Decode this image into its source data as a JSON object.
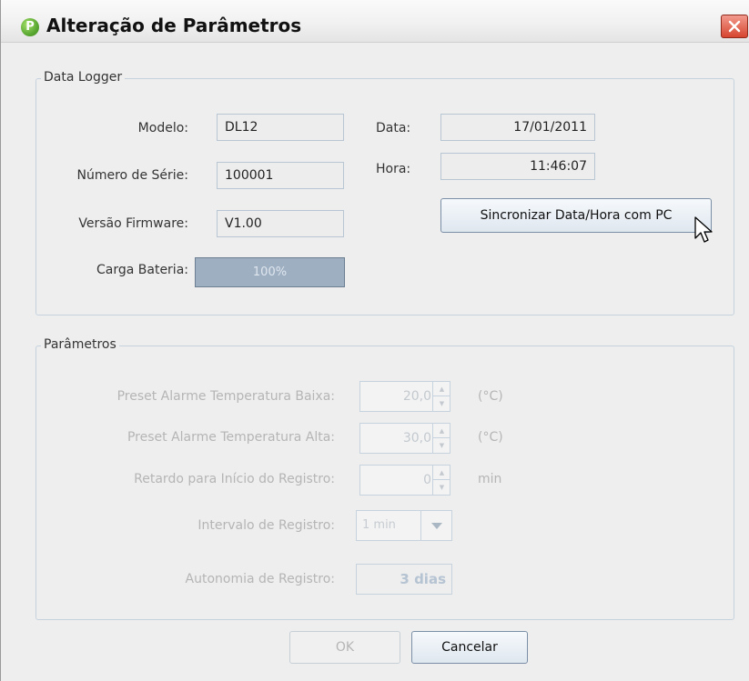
{
  "window": {
    "title": "Alteração de Parâmetros",
    "app_icon_letter": "P"
  },
  "data_logger": {
    "group_title": "Data Logger",
    "modelo_label": "Modelo:",
    "modelo_value": "DL12",
    "numero_serie_label": "Número de Série:",
    "numero_serie_value": "100001",
    "versao_firmware_label": "Versão Firmware:",
    "versao_firmware_value": "V1.00",
    "carga_bateria_label": "Carga Bateria:",
    "carga_bateria_text": "100%",
    "carga_bateria_level": 1.0,
    "data_label": "Data:",
    "data_value": "17/01/2011",
    "hora_label": "Hora:",
    "hora_value": "11:46:07",
    "sync_button_label": "Sincronizar Data/Hora com PC"
  },
  "parametros": {
    "group_title": "Parâmetros",
    "preset_baixa_label": "Preset Alarme Temperatura Baixa:",
    "preset_baixa_value": "20,0",
    "preset_baixa_unit": "(°C)",
    "preset_alta_label": "Preset Alarme Temperatura Alta:",
    "preset_alta_value": "30,0",
    "preset_alta_unit": "(°C)",
    "retardo_label": "Retardo para Início do Registro:",
    "retardo_value": "0",
    "retardo_unit": "min",
    "intervalo_label": "Intervalo de Registro:",
    "intervalo_value": "1 min",
    "autonomia_label": "Autonomia de Registro:",
    "autonomia_value": "3 dias"
  },
  "buttons": {
    "ok_label": "OK",
    "cancel_label": "Cancelar"
  },
  "colors": {
    "window_bg": "#eeeeee",
    "group_border": "#c5d2de",
    "battery_fill": "#a2b2c4",
    "close_button": "#d6452f",
    "disabled_text": "#b5b5b5"
  },
  "icons": {
    "app": "app-logo-icon",
    "close": "close-icon",
    "cursor": "mouse-pointer-icon",
    "spin_up": "spin-up-icon",
    "spin_down": "spin-down-icon",
    "dropdown": "chevron-down-icon"
  }
}
